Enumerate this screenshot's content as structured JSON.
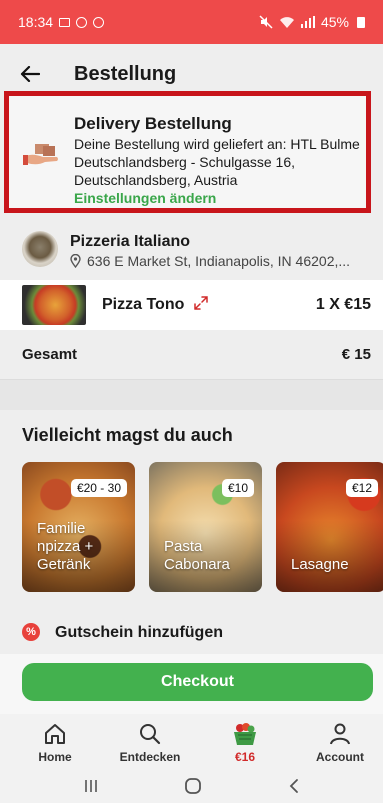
{
  "status_bar": {
    "time": "18:34",
    "battery": "45%"
  },
  "header": {
    "title": "Bestellung"
  },
  "delivery": {
    "title": "Delivery Bestellung",
    "address": "Deine Bestellung wird geliefert an: HTL Bulme Deutschlandsberg - Schulgasse 16, Deutschlandsberg, Austria",
    "change_link": "Einstellungen ändern"
  },
  "restaurant": {
    "name": "Pizzeria Italiano",
    "address": "636 E Market St, Indianapolis, IN 46202,..."
  },
  "order_item": {
    "name": "Pizza Tono",
    "qty_price": "1 X €15"
  },
  "total": {
    "label": "Gesamt",
    "value": "€ 15"
  },
  "suggestions": {
    "title": "Vielleicht magst du auch",
    "items": [
      {
        "label": "Familie npizza + Getränk",
        "price": "€20 - 30"
      },
      {
        "label": "Pasta Cabonara",
        "price": "€10"
      },
      {
        "label": "Lasagne",
        "price": "€12"
      }
    ]
  },
  "voucher": {
    "label": "Gutschein hinzufügen",
    "icon": "percent-icon"
  },
  "checkout": {
    "label": "Checkout"
  },
  "nav": {
    "home": "Home",
    "discover": "Entdecken",
    "cart": "€16",
    "account": "Account"
  },
  "colors": {
    "status_bar": "#ee4a4a",
    "highlight_border": "#c8151b",
    "accent_green": "#43b14e",
    "cart_red": "#d12a2a"
  }
}
